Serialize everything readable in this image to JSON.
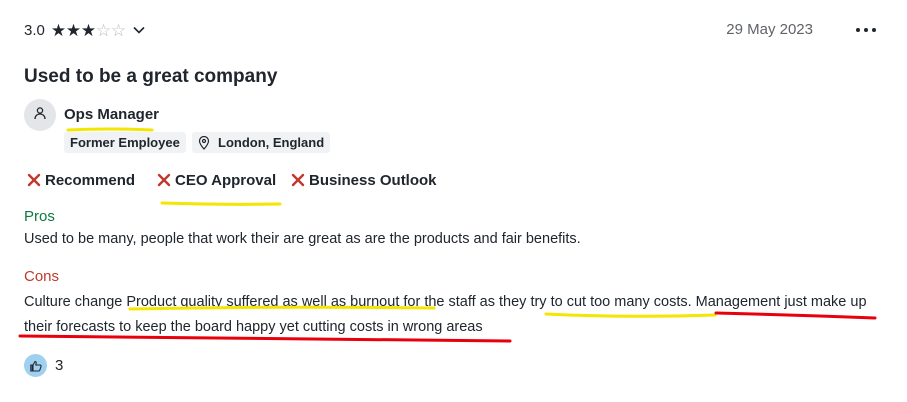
{
  "review": {
    "rating": "3.0",
    "stars_filled": 3,
    "stars_total": 5,
    "date": "29 May 2023",
    "title": "Used to be a great company",
    "author": {
      "job_title": "Ops Manager",
      "status": "Former Employee",
      "location": "London, England"
    },
    "outlook": [
      {
        "label": "Recommend",
        "state": "negative"
      },
      {
        "label": "CEO Approval",
        "state": "negative"
      },
      {
        "label": "Business Outlook",
        "state": "negative"
      }
    ],
    "pros": {
      "label": "Pros",
      "text": "Used to be many, people that work their are great as are the products and fair benefits."
    },
    "cons": {
      "label": "Cons",
      "text": "Culture change Product quality suffered as well as burnout for the staff as they try to cut too many costs. Management just make up their forecasts to keep the board happy yet cutting costs in wrong areas"
    },
    "helpful_count": "3"
  },
  "colors": {
    "accent_pros": "#0c7b3e",
    "accent_cons": "#c0392b",
    "negative_icon": "#c0392b",
    "annotation_yellow": "#f3e600",
    "annotation_red": "#e8000b"
  },
  "icons": {
    "rating_expand": "chevron-down-icon",
    "more": "more-options-icon",
    "avatar": "user-icon",
    "location": "map-pin-icon",
    "negative": "x-icon",
    "helpful": "helpful-hand-icon"
  }
}
